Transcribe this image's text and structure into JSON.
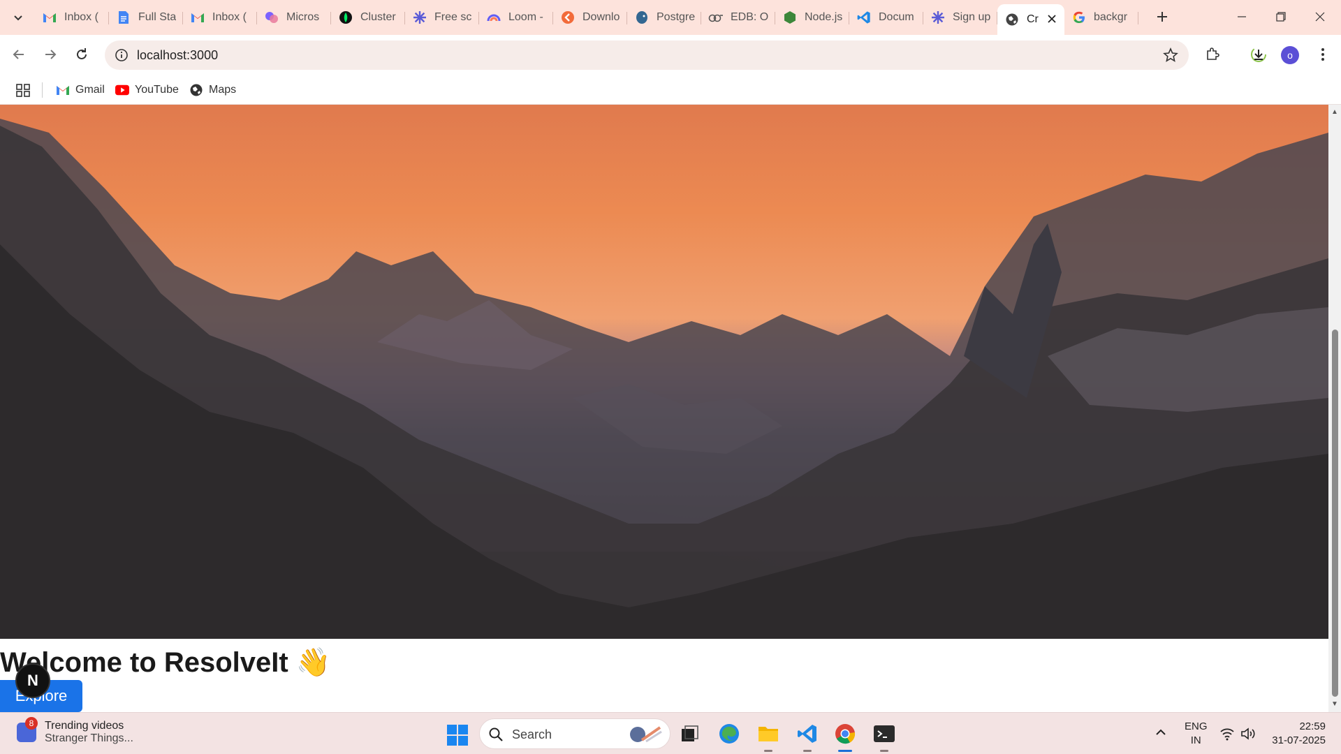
{
  "browser": {
    "tabs": [
      {
        "title": "Inbox (",
        "icon": "gmail-icon"
      },
      {
        "title": "Full Sta",
        "icon": "google-docs-icon"
      },
      {
        "title": "Inbox (",
        "icon": "gmail-icon"
      },
      {
        "title": "Micros",
        "icon": "copilot-icon"
      },
      {
        "title": "Cluster",
        "icon": "mongodb-icon"
      },
      {
        "title": "Free sc",
        "icon": "asterisk-icon"
      },
      {
        "title": "Loom -",
        "icon": "loom-icon"
      },
      {
        "title": "Downlo",
        "icon": "download-site-icon"
      },
      {
        "title": "Postgre",
        "icon": "postgres-icon"
      },
      {
        "title": "EDB: O",
        "icon": "edb-icon"
      },
      {
        "title": "Node.js",
        "icon": "nodejs-icon"
      },
      {
        "title": "Docum",
        "icon": "vscode-icon"
      },
      {
        "title": "Sign up",
        "icon": "asterisk-icon"
      },
      {
        "title": "Cr",
        "icon": "globe-icon",
        "active": true
      },
      {
        "title": "backgr",
        "icon": "google-icon"
      }
    ],
    "url": "localhost:3000",
    "profile_initial": "o",
    "bookmarks": [
      {
        "label": "Gmail",
        "icon": "gmail-icon"
      },
      {
        "label": "YouTube",
        "icon": "youtube-icon"
      },
      {
        "label": "Maps",
        "icon": "maps-icon"
      }
    ]
  },
  "page": {
    "heading": "Welcome to ResolveIt 👋",
    "explore_label": "Explore",
    "next_badge": "N"
  },
  "taskbar": {
    "widget_title": "Trending videos",
    "widget_subtitle": "Stranger Things...",
    "widget_badge": "8",
    "search_placeholder": "Search",
    "lang_line1": "ENG",
    "lang_line2": "IN",
    "time": "22:59",
    "date": "31-07-2025"
  },
  "colors": {
    "accent_button": "#1a73e8",
    "chrome_frame": "#fde3dc",
    "taskbar": "#f3e3e3"
  }
}
